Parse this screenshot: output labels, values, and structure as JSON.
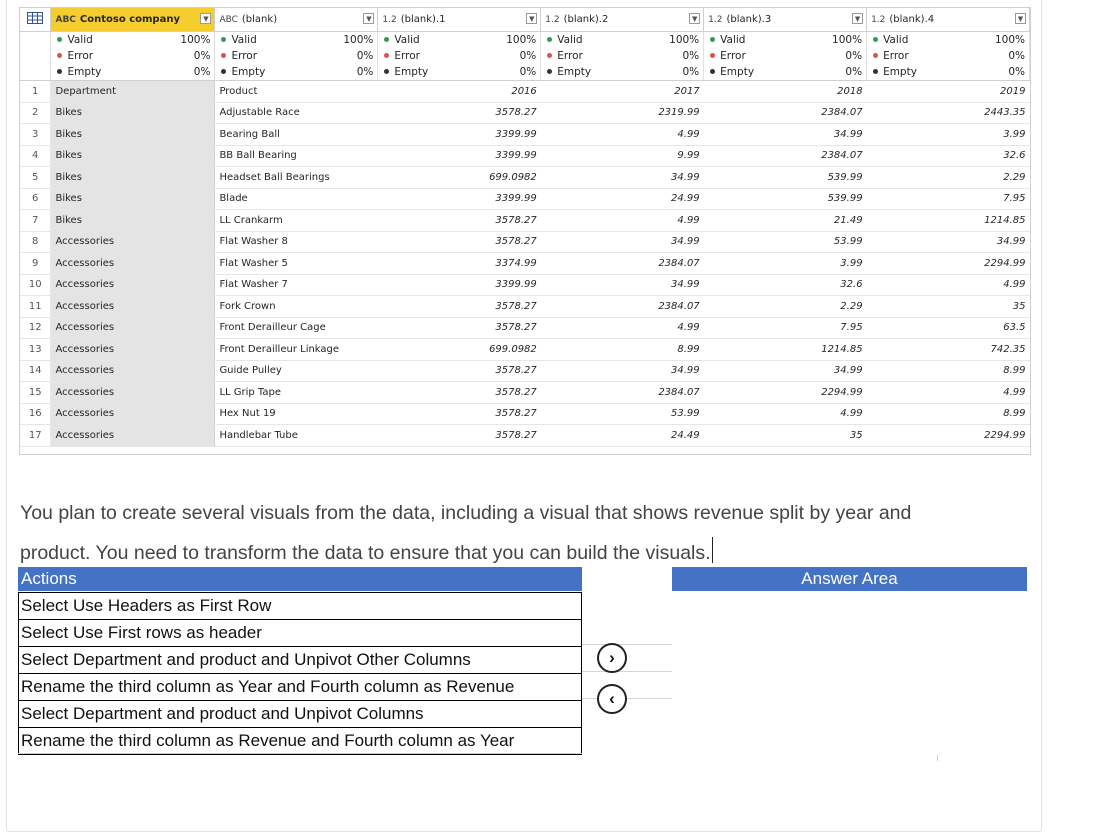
{
  "grid": {
    "columns": [
      {
        "type": "ABC",
        "name": "Contoso company",
        "selected": true
      },
      {
        "type": "ABC",
        "name": "(blank)"
      },
      {
        "type": "1.2",
        "name": "(blank).1"
      },
      {
        "type": "1.2",
        "name": "(blank).2"
      },
      {
        "type": "1.2",
        "name": "(blank).3"
      },
      {
        "type": "1.2",
        "name": "(blank).4"
      }
    ],
    "quality": [
      {
        "valid": "100%",
        "error": "0%",
        "empty": "0%"
      },
      {
        "valid": "100%",
        "error": "0%",
        "empty": "0%"
      },
      {
        "valid": "100%",
        "error": "0%",
        "empty": "0%"
      },
      {
        "valid": "100%",
        "error": "0%",
        "empty": "0%"
      },
      {
        "valid": "100%",
        "error": "0%",
        "empty": "0%"
      },
      {
        "valid": "100%",
        "error": "0%",
        "empty": "0%"
      }
    ],
    "quality_labels": {
      "valid": "Valid",
      "error": "Error",
      "empty": "Empty"
    },
    "rows": [
      [
        "1",
        "Department",
        "Product",
        "2016",
        "2017",
        "2018",
        "2019"
      ],
      [
        "2",
        "Bikes",
        "Adjustable Race",
        "3578.27",
        "2319.99",
        "2384.07",
        "2443.35"
      ],
      [
        "3",
        "Bikes",
        "Bearing Ball",
        "3399.99",
        "4.99",
        "34.99",
        "3.99"
      ],
      [
        "4",
        "Bikes",
        "BB Ball Bearing",
        "3399.99",
        "9.99",
        "2384.07",
        "32.6"
      ],
      [
        "5",
        "Bikes",
        "Headset Ball Bearings",
        "699.0982",
        "34.99",
        "539.99",
        "2.29"
      ],
      [
        "6",
        "Bikes",
        "Blade",
        "3399.99",
        "24.99",
        "539.99",
        "7.95"
      ],
      [
        "7",
        "Bikes",
        "LL Crankarm",
        "3578.27",
        "4.99",
        "21.49",
        "1214.85"
      ],
      [
        "8",
        "Accessories",
        "Flat Washer 8",
        "3578.27",
        "34.99",
        "53.99",
        "34.99"
      ],
      [
        "9",
        "Accessories",
        "Flat Washer 5",
        "3374.99",
        "2384.07",
        "3.99",
        "2294.99"
      ],
      [
        "10",
        "Accessories",
        "Flat Washer 7",
        "3399.99",
        "34.99",
        "32.6",
        "4.99"
      ],
      [
        "11",
        "Accessories",
        "Fork Crown",
        "3578.27",
        "2384.07",
        "2.29",
        "35"
      ],
      [
        "12",
        "Accessories",
        "Front Derailleur Cage",
        "3578.27",
        "4.99",
        "7.95",
        "63.5"
      ],
      [
        "13",
        "Accessories",
        "Front Derailleur Linkage",
        "699.0982",
        "8.99",
        "1214.85",
        "742.35"
      ],
      [
        "14",
        "Accessories",
        "Guide Pulley",
        "3578.27",
        "34.99",
        "34.99",
        "8.99"
      ],
      [
        "15",
        "Accessories",
        "LL Grip Tape",
        "3578.27",
        "2384.07",
        "2294.99",
        "4.99"
      ],
      [
        "16",
        "Accessories",
        "Hex Nut 19",
        "3578.27",
        "53.99",
        "4.99",
        "8.99"
      ],
      [
        "17",
        "Accessories",
        "Handlebar Tube",
        "3578.27",
        "24.49",
        "35",
        "2294.99"
      ]
    ]
  },
  "prompt": {
    "line1": "You plan to create several visuals from the data, including a visual that shows revenue split by year and",
    "line2": "product. You need to transform the data to ensure that you can build the visuals."
  },
  "actions_header": "Actions",
  "answer_header": "Answer Area",
  "actions": [
    "Select Use Headers as First Row",
    "Select Use First rows as header",
    "Select Department and product and Unpivot Other Columns",
    "Rename the third column as Year and Fourth column as Revenue",
    "Select Department and product and Unpivot Columns",
    "Rename the third column as Revenue and Fourth column as Year"
  ],
  "buttons": {
    "move_right": "›",
    "move_left": "‹"
  },
  "colors": {
    "accent": "#4472c4",
    "selected_column": "#f5cd2e",
    "valid": "#2e9b5a",
    "error": "#d9534f"
  }
}
